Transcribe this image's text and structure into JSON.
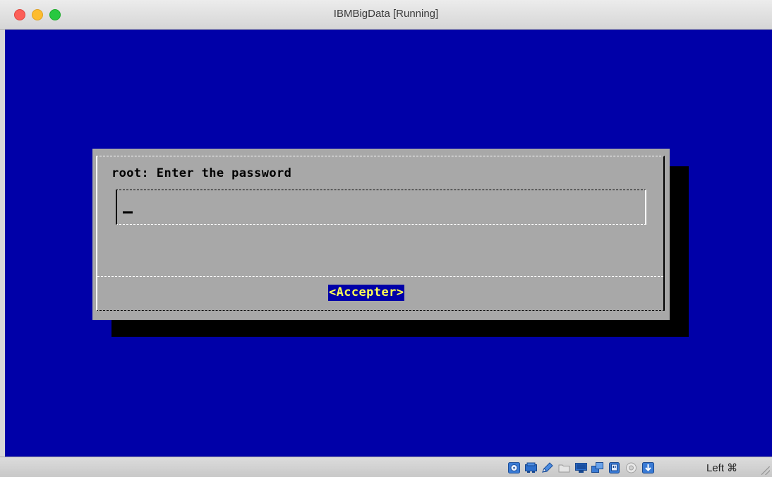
{
  "window": {
    "title": "IBMBigData [Running]"
  },
  "dialog": {
    "prompt": "root: Enter the password",
    "password_value": "",
    "accept_label": "<Accepter>"
  },
  "colors": {
    "console_background": "#0000a8",
    "dialog_background": "#a8a8a8",
    "button_highlight_bg": "#0000a8",
    "button_highlight_fg": "#ffff54"
  },
  "statusbar": {
    "icons": [
      "hard-disk-icon",
      "optical-drive-icon",
      "audio-icon",
      "shared-folder-icon",
      "display-icon",
      "network-icon",
      "usb-icon",
      "recording-icon",
      "mouse-integration-icon"
    ],
    "host_key": "Left ⌘"
  }
}
